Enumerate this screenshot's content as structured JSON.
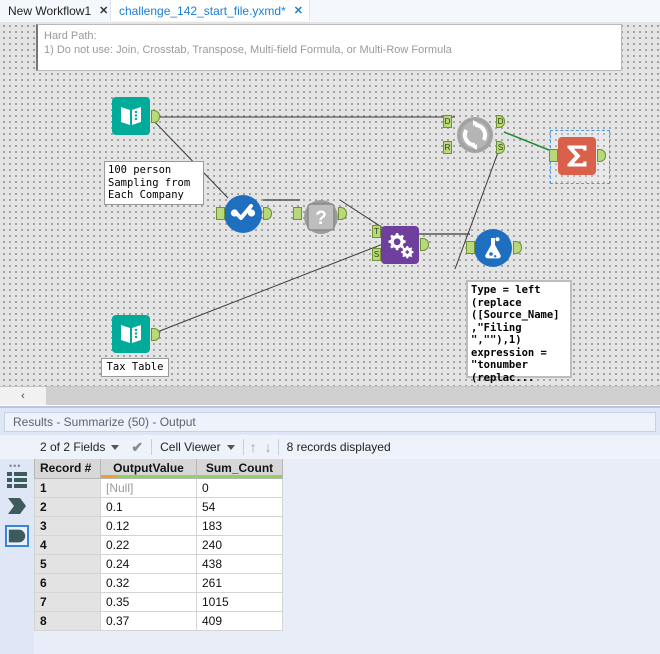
{
  "tabs": [
    {
      "label": "New Workflow1",
      "close": "✕",
      "active": false
    },
    {
      "label": "challenge_142_start_file.yxmd*",
      "close": "✕",
      "active": true
    }
  ],
  "canvas": {
    "comment": {
      "line1": "Hard Path:",
      "line2": "1) Do not use: Join, Crosstab, Transpose, Multi-field Formula, or Multi-Row Formula"
    },
    "nodes": [
      {
        "name": "input-data-tool-1",
        "icon": "book-icon",
        "color": "#00ab9a",
        "label": "100 person\nSampling from\nEach Company"
      },
      {
        "name": "select-tool",
        "icon": "check-dots-icon",
        "color": "#1f6fc0"
      },
      {
        "name": "macro-unknown-tool",
        "icon": "question-mark-icon",
        "color": "#9a9a9a"
      },
      {
        "name": "multi-field-tool",
        "icon": "gears-icon",
        "color": "#6f3f9e"
      },
      {
        "name": "formula-flask-tool",
        "icon": "flask-icon",
        "color": "#1f6fc0"
      },
      {
        "name": "dynamic-rename-tool",
        "icon": "refresh-circle-icon",
        "color": "#9a9a9a"
      },
      {
        "name": "summarize-tool",
        "icon": "sigma-icon",
        "color": "#d9614c",
        "selected": true
      },
      {
        "name": "input-data-tool-2",
        "icon": "book-icon",
        "color": "#00ab9a",
        "label": "Tax Table"
      }
    ],
    "annotation": "Type = left\n(replace\n([Source_Name]\n,\"Filing\n\",\"\"),1)\nexpression =\n\"tonumber\n(replac...",
    "anchors": {
      "d": "D",
      "r": "R",
      "s": "S",
      "t": "T"
    },
    "scroll_left_icon": "‹"
  },
  "results": {
    "title": "Results - Summarize (50) - Output",
    "toolbar": {
      "fields": "2 of 2 Fields",
      "check_icon": "✔",
      "viewer": "Cell Viewer",
      "up_icon": "↑",
      "down_icon": "↓",
      "records": "8 records displayed"
    },
    "rail": {
      "dots": "•••",
      "items": [
        {
          "name": "rail-item-grid",
          "icon": "list-grid-icon"
        },
        {
          "name": "rail-item-input",
          "icon": "input-anchor-icon"
        },
        {
          "name": "rail-item-output",
          "icon": "output-anchor-icon",
          "selected": true
        }
      ]
    },
    "table": {
      "columns": [
        "Record #",
        "OutputValue",
        "Sum_Count"
      ],
      "rows": [
        {
          "record": "1",
          "output_value": "[Null]",
          "sum_count": "0",
          "null": true
        },
        {
          "record": "2",
          "output_value": "0.1",
          "sum_count": "54"
        },
        {
          "record": "3",
          "output_value": "0.12",
          "sum_count": "183"
        },
        {
          "record": "4",
          "output_value": "0.22",
          "sum_count": "240"
        },
        {
          "record": "5",
          "output_value": "0.24",
          "sum_count": "438"
        },
        {
          "record": "6",
          "output_value": "0.32",
          "sum_count": "261"
        },
        {
          "record": "7",
          "output_value": "0.35",
          "sum_count": "1015"
        },
        {
          "record": "8",
          "output_value": "0.37",
          "sum_count": "409"
        }
      ]
    }
  }
}
